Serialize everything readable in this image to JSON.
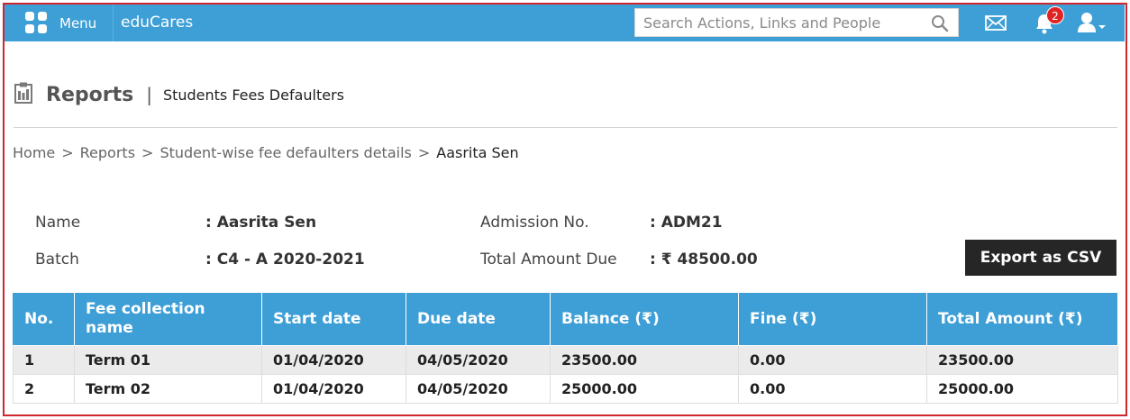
{
  "topbar": {
    "menu_label": "Menu",
    "brand": "eduCares",
    "search_placeholder": "Search Actions, Links and People",
    "notification_count": "2"
  },
  "header": {
    "title": "Reports",
    "separator": "|",
    "subtitle": "Students Fees Defaulters"
  },
  "breadcrumb": {
    "items": [
      "Home",
      "Reports",
      "Student-wise fee defaulters details"
    ],
    "current": "Aasrita Sen",
    "separator": ">"
  },
  "student": {
    "name_label": "Name",
    "name_value": ": Aasrita Sen",
    "batch_label": "Batch",
    "batch_value": ": C4 - A 2020-2021",
    "admission_label": "Admission No.",
    "admission_value": ": ADM21",
    "total_due_label": "Total Amount Due",
    "total_due_value": ": ₹ 48500.00"
  },
  "export_label": "Export as CSV",
  "table": {
    "columns": [
      "No.",
      "Fee collection name",
      "Start date",
      "Due date",
      "Balance (₹)",
      "Fine (₹)",
      "Total Amount (₹)"
    ],
    "rows": [
      [
        "1",
        "Term 01",
        "01/04/2020",
        "04/05/2020",
        "23500.00",
        "0.00",
        "23500.00"
      ],
      [
        "2",
        "Term 02",
        "01/04/2020",
        "04/05/2020",
        "25000.00",
        "0.00",
        "25000.00"
      ]
    ]
  },
  "colors": {
    "brand_blue": "#3e9fd6",
    "export_button": "#262626",
    "badge": "#e02424",
    "frame": "#d0262e"
  },
  "icons": [
    "menu-grid-icon",
    "search-icon",
    "mail-icon",
    "bell-icon",
    "user-icon",
    "chevron-down-icon",
    "report-clipboard-icon"
  ]
}
